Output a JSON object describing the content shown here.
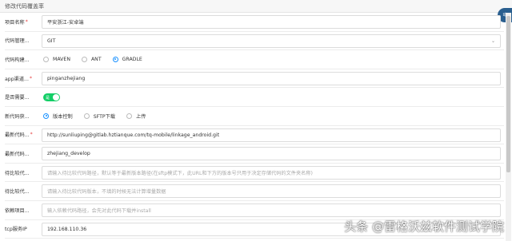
{
  "dialog": {
    "title": "修改代码覆盖率",
    "corner_badge": "动"
  },
  "fields": {
    "project_name": {
      "label": "项目名称",
      "required": "*",
      "value": "平安浙江-安卓端"
    },
    "code_mgmt": {
      "label": "代码管理...",
      "value": "GIT"
    },
    "code_build": {
      "label": "代码构建...",
      "options": [
        "MAVEN",
        "ANT",
        "GRADLE"
      ],
      "selected": "GRADLE"
    },
    "app_channel": {
      "label": "app渠道...",
      "required": "*",
      "value": "pinganzhejiang"
    },
    "need": {
      "label": "是否需要...",
      "toggle_text": "是",
      "on": true
    },
    "new_code_get": {
      "label": "新代码获...",
      "options": [
        "版本控制",
        "SFTP下载",
        "上传"
      ],
      "selected": "版本控制"
    },
    "latest_code": {
      "label": "最新代码...",
      "required": "*",
      "value": "http://sunliuping@gitlab.hztianque.com/tq-mobile/linkage_android.git"
    },
    "latest_code_branch": {
      "label": "最新代码...",
      "value": "zhejiang_develop"
    },
    "compare_code_path": {
      "label": "待比较代...",
      "placeholder": "请输入待比较代码路径，默认等于最新版本路径(在sftp模式下，此URL和下方的版本号只用于决定存储代码的文件夹名称)"
    },
    "compare_code_version": {
      "label": "待比较代...",
      "placeholder": "请输入待比较代码版本，不填的时候无法计算增量数据"
    },
    "dep_project": {
      "label": "依赖项目...",
      "placeholder": "输入依赖代码路径，会先对此代码下载并install"
    },
    "tcp_ip": {
      "label": "tcp服务IP",
      "value": "192.168.110.36"
    }
  },
  "watermark": "头条 @雷格沃兹软件测试学院"
}
